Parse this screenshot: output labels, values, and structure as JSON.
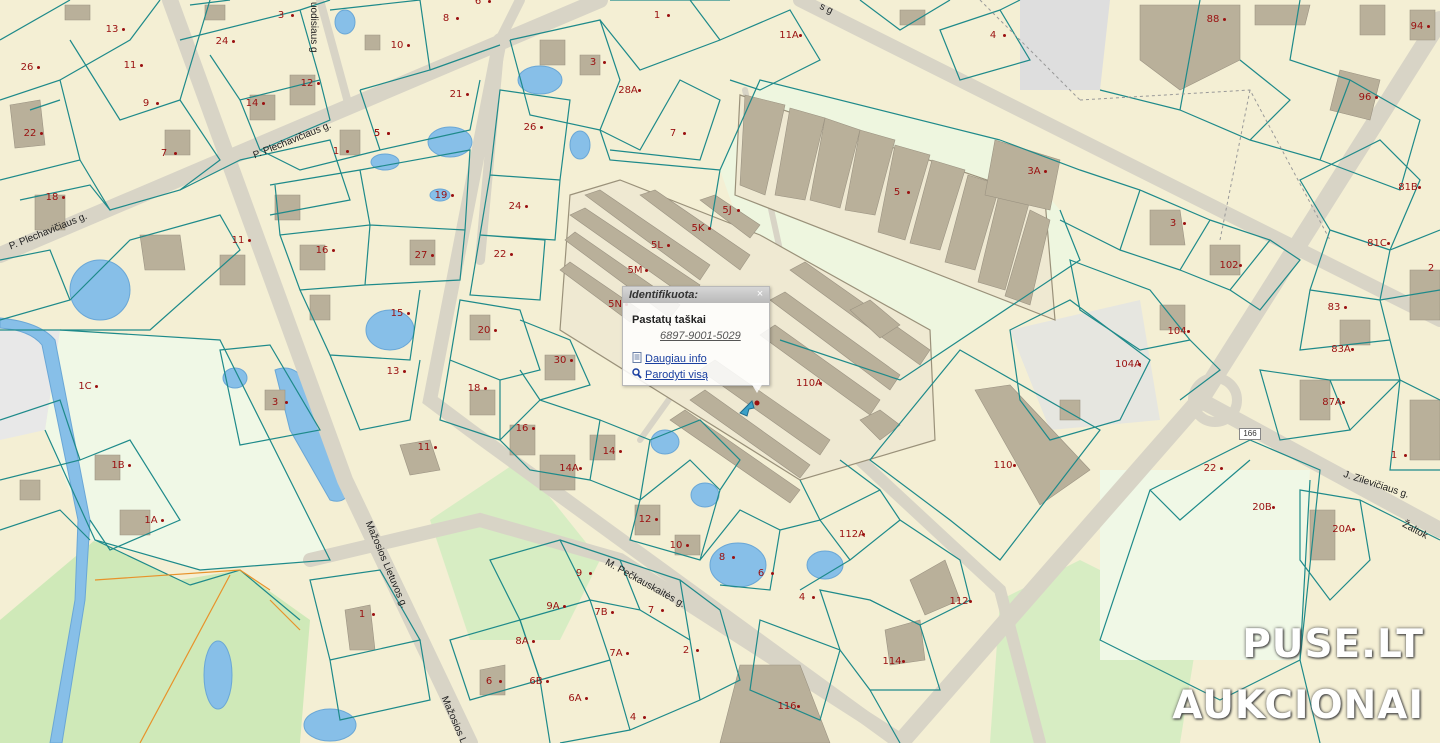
{
  "popup": {
    "header": "Identifikuota:",
    "close_symbol": "×",
    "title": "Pastatų taškai",
    "id": "6897-9001-5029",
    "more_info": "Daugiau info",
    "show_all": "Parodyti visą"
  },
  "watermark": {
    "line1": "PUSE.LT",
    "line2": "AUKCIONAI"
  },
  "route_badge": "166",
  "streets": [
    "P. Plechavičiaus g.",
    "P. Plechavičiaus g.",
    "Mažosios Lietuvos g.",
    "Mažosios L",
    "M. Pečkauskaitės g.",
    "J. Zilevičiaus g.",
    "Žaltok",
    "uodisiaus g",
    "s g"
  ],
  "plots": [
    "13",
    "26",
    "11",
    "9",
    "7",
    "24",
    "3",
    "14",
    "12",
    "10",
    "8",
    "6",
    "1",
    "11A",
    "4",
    "88",
    "94",
    "96",
    "22",
    "18",
    "21",
    "5",
    "19",
    "27",
    "15",
    "16",
    "3",
    "13",
    "1C",
    "1B",
    "1A",
    "11",
    "20",
    "30",
    "18",
    "16",
    "14",
    "14A",
    "12",
    "10",
    "8",
    "6",
    "4",
    "9",
    "9A",
    "7B",
    "7",
    "8A",
    "7A",
    "2",
    "6B",
    "6A",
    "4",
    "116",
    "114",
    "112",
    "112A",
    "110",
    "110A",
    "5N",
    "5M",
    "5L",
    "5K",
    "5J",
    "28A",
    "26",
    "24",
    "22",
    "3A",
    "5",
    "3",
    "102",
    "104",
    "104A",
    "81B",
    "81C",
    "83",
    "83A",
    "87A",
    "2",
    "1",
    "22",
    "20B",
    "20A",
    "1",
    "7",
    "3",
    "5",
    "1",
    "11",
    "6",
    "8"
  ],
  "colors": {
    "land": "#f4efd4",
    "parcel_line": "#1e8a8a",
    "building": "#b9b09a",
    "road": "#e0ddd2",
    "water": "#87bfe8",
    "green": "#d4ecc0",
    "pale_green": "#eef7e4",
    "label": "#9a1010"
  }
}
